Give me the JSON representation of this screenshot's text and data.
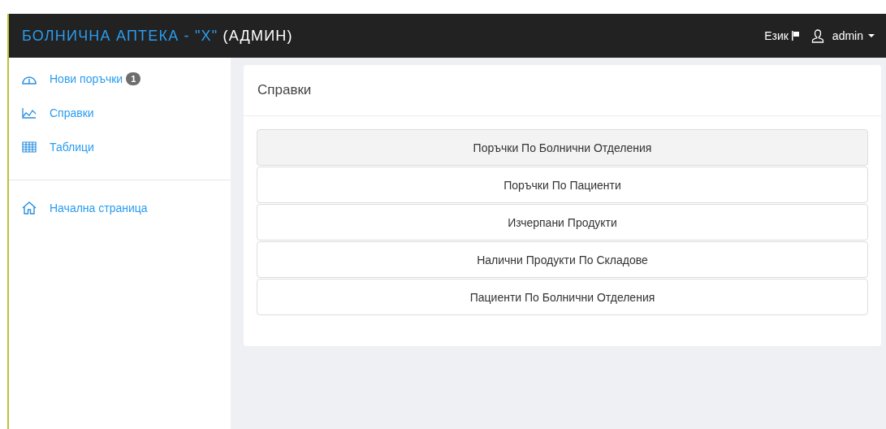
{
  "navbar": {
    "brand": "БОЛНИЧНА АПТЕКА - \"Х\"",
    "brand_suffix": "(АДМИН)",
    "language": "Език",
    "user": "admin"
  },
  "sidebar": {
    "items": [
      {
        "label": "Нови поръчки",
        "kind": "orders",
        "badge": "1"
      },
      {
        "label": "Справки",
        "kind": "reports"
      },
      {
        "label": "Таблици",
        "kind": "tables"
      }
    ],
    "bottom_items": [
      {
        "label": "Начална страница",
        "kind": "home"
      }
    ]
  },
  "panel": {
    "title": "Справки",
    "reports": [
      {
        "label": "Поръчки По Болнични Отделения",
        "selected": true
      },
      {
        "label": "Поръчки По Пациенти",
        "selected": false
      },
      {
        "label": "Изчерпани Продукти",
        "selected": false
      },
      {
        "label": "Налични Продукти По Складове",
        "selected": false
      },
      {
        "label": "Пациенти По Болнични Отделения",
        "selected": false
      }
    ]
  }
}
